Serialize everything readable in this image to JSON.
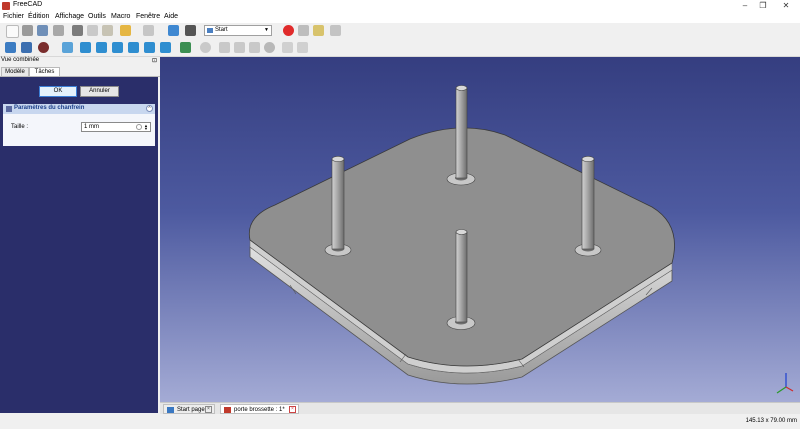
{
  "window": {
    "title": "FreeCAD",
    "controls": [
      "–",
      "❐",
      "✕"
    ]
  },
  "menu": [
    "Fichier",
    "Édition",
    "Affichage",
    "Outils",
    "Macro",
    "Fenêtre",
    "Aide"
  ],
  "workbench": {
    "selected": "Start"
  },
  "combo_view": {
    "title": "Vue combinée",
    "tabs": [
      "Modèle",
      "Tâches"
    ],
    "active_tab": "Tâches",
    "ok_label": "OK",
    "cancel_label": "Annuler",
    "chamfer": {
      "header": "Paramètres du chanfrein",
      "size_label": "Taille :",
      "size_value": "1 mm"
    }
  },
  "doc_tabs": [
    {
      "label": "Start page"
    },
    {
      "label": "porte brossette : 1*"
    }
  ],
  "status": {
    "dimensions": "145.13 x 79.00 mm"
  },
  "colors": {
    "viewport_top": "#353e80",
    "viewport_bottom": "#a4abd5",
    "task_panel": "#2a2e6a",
    "model_face": "#8f8f8f"
  }
}
